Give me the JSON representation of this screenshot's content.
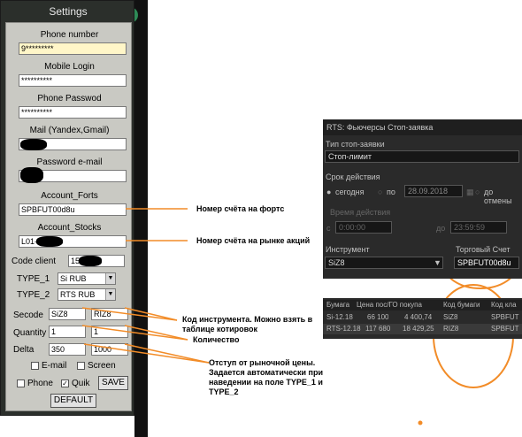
{
  "settings": {
    "title": "Settings",
    "phone_number_label": "Phone number",
    "phone_number_value": "9*********",
    "mobile_login_label": "Mobile Login",
    "mobile_login_value": "**********",
    "phone_password_label": "Phone Passwod",
    "phone_password_value": "**********",
    "mail_label": "Mail (Yandex,Gmail)",
    "password_email_label": "Password e-mail",
    "account_forts_label": "Account_Forts",
    "account_forts_value": "SPBFUT00d8u",
    "account_stocks_label": "Account_Stocks",
    "account_stocks_value": "L01-",
    "code_client_label": "Code client",
    "code_client_value": "15",
    "type1_label": "TYPE_1",
    "type1_value": "Si RUB",
    "type2_label": "TYPE_2",
    "type2_value": "RTS RUB",
    "secode_label": "Secode",
    "secode_1": "SiZ8",
    "secode_2": "RIZ8",
    "quantity_label": "Quantity",
    "quantity_1": "1",
    "quantity_2": "1",
    "delta_label": "Delta",
    "delta_1": "350",
    "delta_2": "1000",
    "email_check_label": "E-mail",
    "screen_check_label": "Screen",
    "phone_check_label": "Phone",
    "quik_check_label": "Quik",
    "quik_checked": true,
    "save_button": "SAVE",
    "default_button": "DEFAULT"
  },
  "annotations": {
    "forts": "Номер счёта на фортс",
    "stocks": "Номер счёта на рынке акций",
    "secode": "Код инструмента. Можно взять в таблице котировок",
    "quantity": "Количество",
    "delta": "Отступ от рыночной цены. Задается автоматически при наведении на поле TYPE_1 и TYPE_2"
  },
  "rts_panel": {
    "title": "RTS: Фьючерсы Стоп-заявка",
    "stop_type_label": "Тип стоп-заявки",
    "stop_type_value": "Стоп-лимит",
    "validity_label": "Срок действия",
    "opt_today": "сегодня",
    "opt_until": "по",
    "until_date": "28.09.2018",
    "opt_cancel": "до отмены",
    "action_time_label": "Время действия",
    "time_from_label": "с",
    "time_from": "0:00:00",
    "time_to_label": "до",
    "time_to": "23:59:59",
    "instrument_label": "Инструмент",
    "instrument_value": "SiZ8",
    "account_label": "Торговый Счет",
    "account_value": "SPBFUT00d8u"
  },
  "quotes_table": {
    "headers": [
      "Бумага",
      "Цена пос/ГО покупа",
      "Код бумаги",
      "Код кла"
    ],
    "rows": [
      [
        "Si-12.18",
        "66 100",
        "4 400,74",
        "SiZ8",
        "SPBFUT"
      ],
      [
        "RTS-12.18",
        "117 680",
        "18 429,25",
        "RIZ8",
        "SPBFUT"
      ]
    ]
  },
  "colors": {
    "accent_orange": "#f28c28",
    "annotation_line": "#f28c28"
  }
}
